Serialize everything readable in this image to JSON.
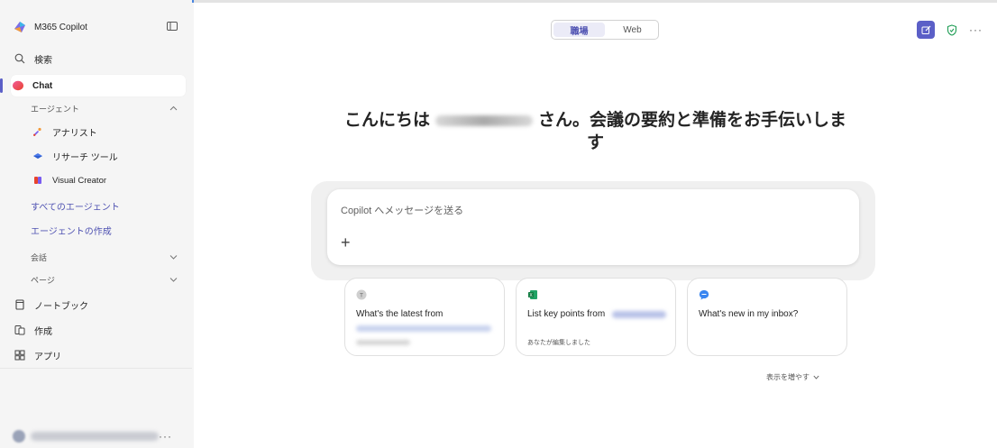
{
  "app": {
    "title": "M365 Copilot"
  },
  "sidebar": {
    "search": "検索",
    "chat": "Chat",
    "agents_header": "エージェント",
    "agents": [
      {
        "label": "アナリスト",
        "icon": "analyst-icon"
      },
      {
        "label": "リサーチ ツール",
        "icon": "researcher-icon"
      },
      {
        "label": "Visual Creator",
        "icon": "visual-creator-icon"
      }
    ],
    "all_agents": "すべてのエージェント",
    "create_agent": "エージェントの作成",
    "conversations": "会話",
    "pages": "ページ",
    "notebook": "ノートブック",
    "create": "作成",
    "apps": "アプリ"
  },
  "mode_toggle": {
    "work": "職場",
    "web": "Web",
    "selected": "職場"
  },
  "greeting": {
    "hello": "こんにちは",
    "suffix": "さん。会議の要約と準備をお手伝いしま",
    "line2": "す"
  },
  "composer": {
    "placeholder": "Copilot へメッセージを送る",
    "plus": "+"
  },
  "suggestions": [
    {
      "icon": "teams-icon",
      "title": "What's the latest from"
    },
    {
      "icon": "excel-icon",
      "title": "List key points from",
      "subtitle": "あなたが編集しました"
    },
    {
      "icon": "copilot-chat-icon",
      "title": "What's new in my inbox?"
    }
  ],
  "show_more": "表示を増やす",
  "colors": {
    "accent": "#5b5fc7",
    "link": "#4f52b2",
    "top_accent": "#4a86e0"
  }
}
